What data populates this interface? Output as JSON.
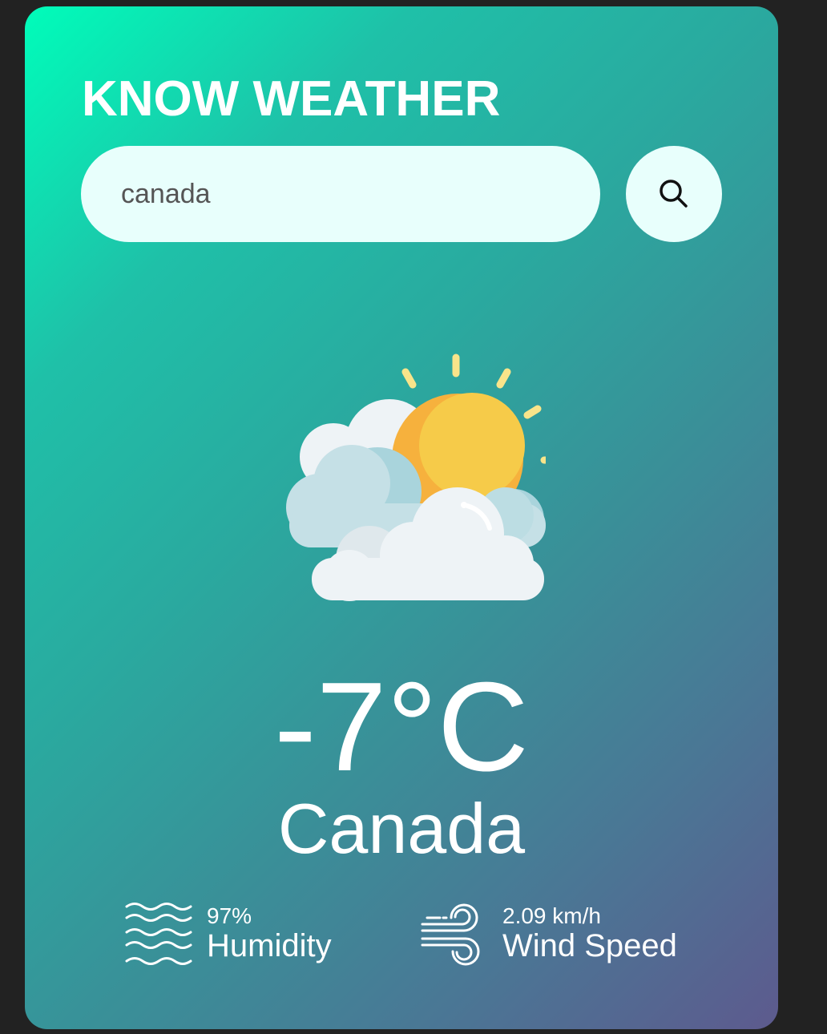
{
  "app": {
    "title": "KNOW WEATHER"
  },
  "search": {
    "value": "canada",
    "icon": "search-icon"
  },
  "weather": {
    "condition_icon": "partly-cloudy-icon",
    "temperature": "-7°C",
    "city": "Canada"
  },
  "details": {
    "humidity": {
      "value": "97%",
      "label": "Humidity",
      "icon": "humidity-icon"
    },
    "wind": {
      "value": "2.09 km/h",
      "label": "Wind Speed",
      "icon": "wind-icon"
    }
  },
  "colors": {
    "page_background": "#222222",
    "gradient_start": "#00fdba",
    "gradient_end": "#5d5a8e",
    "input_background": "#e8fffc",
    "text": "#ffffff"
  }
}
